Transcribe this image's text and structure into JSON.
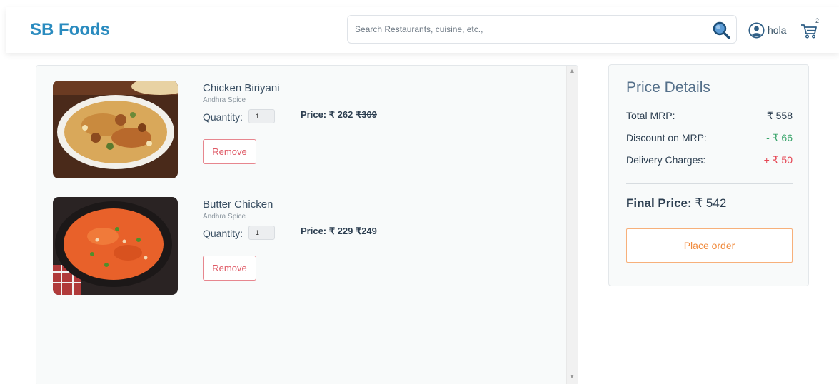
{
  "header": {
    "brand": "SB Foods",
    "search_placeholder": "Search Restaurants, cuisine, etc.,",
    "profile_name": "hola",
    "cart_count": "2"
  },
  "cart": {
    "items": [
      {
        "name": "Chicken Biriyani",
        "restaurant": "Andhra Spice",
        "quantity_label": "Quantity:",
        "quantity": "1",
        "price_label": "Price: ₹ 262",
        "old_price": "₹309",
        "remove_label": "Remove"
      },
      {
        "name": "Butter Chicken",
        "restaurant": "Andhra Spice",
        "quantity_label": "Quantity:",
        "quantity": "1",
        "price_label": "Price: ₹ 229",
        "old_price": "₹249",
        "remove_label": "Remove"
      }
    ]
  },
  "price_details": {
    "title": "Price Details",
    "rows": [
      {
        "label": "Total MRP:",
        "value": "₹ 558"
      },
      {
        "label": "Discount on MRP:",
        "value": "- ₹ 66"
      },
      {
        "label": "Delivery Charges:",
        "value": "+ ₹ 50"
      }
    ],
    "final_label": "Final Price:",
    "final_value": "₹ 542",
    "place_order_label": "Place order"
  },
  "colors": {
    "brand": "#2a8bbf",
    "discount": "#3aa56b",
    "delivery": "#e54553",
    "remove": "#df5a66",
    "place_order": "#f08a3c"
  }
}
